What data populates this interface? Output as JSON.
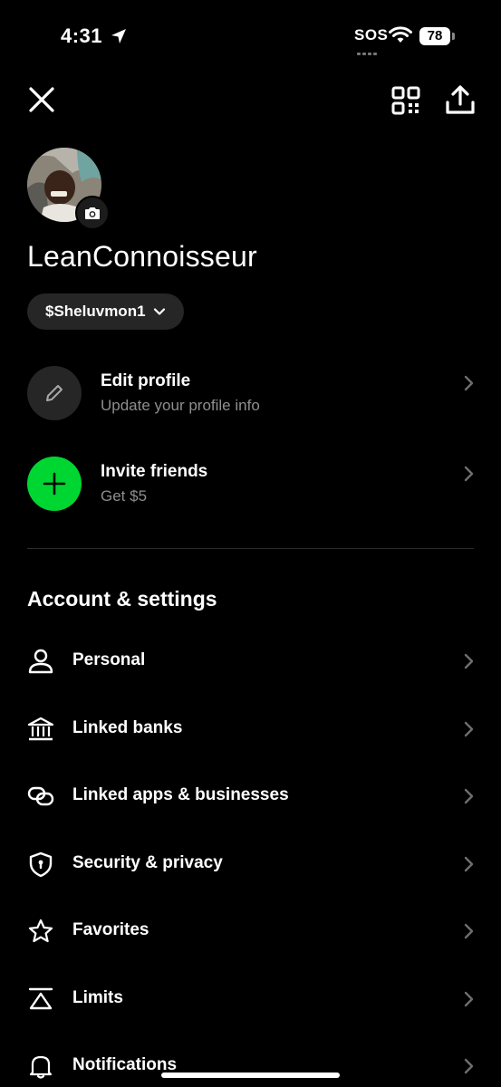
{
  "status_bar": {
    "time": "4:31",
    "carrier": "SOS",
    "battery": "78"
  },
  "profile": {
    "display_name": "LeanConnoisseur",
    "cashtag": "$Sheluvmon1"
  },
  "cards": [
    {
      "title": "Edit profile",
      "subtitle": "Update your profile info",
      "icon": "pencil-icon"
    },
    {
      "title": "Invite friends",
      "subtitle": "Get $5",
      "icon": "plus-icon",
      "icon_bg": "#00d632"
    }
  ],
  "account_settings": {
    "title": "Account & settings",
    "items": [
      {
        "label": "Personal",
        "icon": "person-icon"
      },
      {
        "label": "Linked banks",
        "icon": "bank-icon"
      },
      {
        "label": "Linked apps & businesses",
        "icon": "link-icon"
      },
      {
        "label": "Security & privacy",
        "icon": "shield-icon"
      },
      {
        "label": "Favorites",
        "icon": "star-icon"
      },
      {
        "label": "Limits",
        "icon": "limits-icon"
      },
      {
        "label": "Notifications",
        "icon": "bell-icon"
      }
    ]
  },
  "colors": {
    "background": "#000000",
    "accent": "#00d632",
    "secondary_text": "#8e8e8e",
    "pill_bg": "#262626"
  }
}
